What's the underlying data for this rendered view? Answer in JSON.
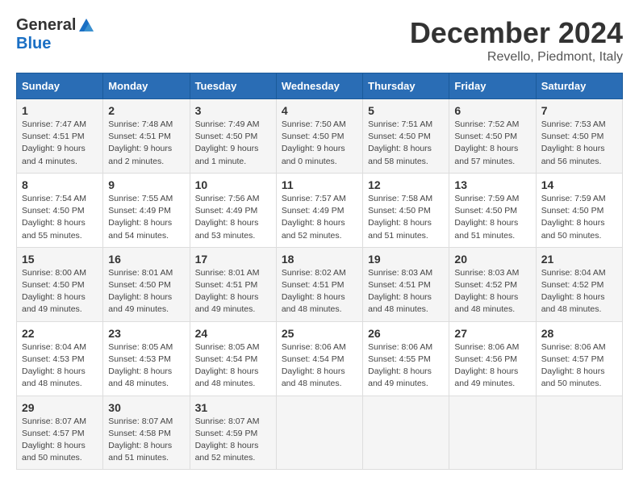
{
  "header": {
    "logo_general": "General",
    "logo_blue": "Blue",
    "title": "December 2024",
    "subtitle": "Revello, Piedmont, Italy"
  },
  "days_of_week": [
    "Sunday",
    "Monday",
    "Tuesday",
    "Wednesday",
    "Thursday",
    "Friday",
    "Saturday"
  ],
  "weeks": [
    [
      {
        "day": "1",
        "detail": "Sunrise: 7:47 AM\nSunset: 4:51 PM\nDaylight: 9 hours\nand 4 minutes."
      },
      {
        "day": "2",
        "detail": "Sunrise: 7:48 AM\nSunset: 4:51 PM\nDaylight: 9 hours\nand 2 minutes."
      },
      {
        "day": "3",
        "detail": "Sunrise: 7:49 AM\nSunset: 4:50 PM\nDaylight: 9 hours\nand 1 minute."
      },
      {
        "day": "4",
        "detail": "Sunrise: 7:50 AM\nSunset: 4:50 PM\nDaylight: 9 hours\nand 0 minutes."
      },
      {
        "day": "5",
        "detail": "Sunrise: 7:51 AM\nSunset: 4:50 PM\nDaylight: 8 hours\nand 58 minutes."
      },
      {
        "day": "6",
        "detail": "Sunrise: 7:52 AM\nSunset: 4:50 PM\nDaylight: 8 hours\nand 57 minutes."
      },
      {
        "day": "7",
        "detail": "Sunrise: 7:53 AM\nSunset: 4:50 PM\nDaylight: 8 hours\nand 56 minutes."
      }
    ],
    [
      {
        "day": "8",
        "detail": "Sunrise: 7:54 AM\nSunset: 4:50 PM\nDaylight: 8 hours\nand 55 minutes."
      },
      {
        "day": "9",
        "detail": "Sunrise: 7:55 AM\nSunset: 4:49 PM\nDaylight: 8 hours\nand 54 minutes."
      },
      {
        "day": "10",
        "detail": "Sunrise: 7:56 AM\nSunset: 4:49 PM\nDaylight: 8 hours\nand 53 minutes."
      },
      {
        "day": "11",
        "detail": "Sunrise: 7:57 AM\nSunset: 4:49 PM\nDaylight: 8 hours\nand 52 minutes."
      },
      {
        "day": "12",
        "detail": "Sunrise: 7:58 AM\nSunset: 4:50 PM\nDaylight: 8 hours\nand 51 minutes."
      },
      {
        "day": "13",
        "detail": "Sunrise: 7:59 AM\nSunset: 4:50 PM\nDaylight: 8 hours\nand 51 minutes."
      },
      {
        "day": "14",
        "detail": "Sunrise: 7:59 AM\nSunset: 4:50 PM\nDaylight: 8 hours\nand 50 minutes."
      }
    ],
    [
      {
        "day": "15",
        "detail": "Sunrise: 8:00 AM\nSunset: 4:50 PM\nDaylight: 8 hours\nand 49 minutes."
      },
      {
        "day": "16",
        "detail": "Sunrise: 8:01 AM\nSunset: 4:50 PM\nDaylight: 8 hours\nand 49 minutes."
      },
      {
        "day": "17",
        "detail": "Sunrise: 8:01 AM\nSunset: 4:51 PM\nDaylight: 8 hours\nand 49 minutes."
      },
      {
        "day": "18",
        "detail": "Sunrise: 8:02 AM\nSunset: 4:51 PM\nDaylight: 8 hours\nand 48 minutes."
      },
      {
        "day": "19",
        "detail": "Sunrise: 8:03 AM\nSunset: 4:51 PM\nDaylight: 8 hours\nand 48 minutes."
      },
      {
        "day": "20",
        "detail": "Sunrise: 8:03 AM\nSunset: 4:52 PM\nDaylight: 8 hours\nand 48 minutes."
      },
      {
        "day": "21",
        "detail": "Sunrise: 8:04 AM\nSunset: 4:52 PM\nDaylight: 8 hours\nand 48 minutes."
      }
    ],
    [
      {
        "day": "22",
        "detail": "Sunrise: 8:04 AM\nSunset: 4:53 PM\nDaylight: 8 hours\nand 48 minutes."
      },
      {
        "day": "23",
        "detail": "Sunrise: 8:05 AM\nSunset: 4:53 PM\nDaylight: 8 hours\nand 48 minutes."
      },
      {
        "day": "24",
        "detail": "Sunrise: 8:05 AM\nSunset: 4:54 PM\nDaylight: 8 hours\nand 48 minutes."
      },
      {
        "day": "25",
        "detail": "Sunrise: 8:06 AM\nSunset: 4:54 PM\nDaylight: 8 hours\nand 48 minutes."
      },
      {
        "day": "26",
        "detail": "Sunrise: 8:06 AM\nSunset: 4:55 PM\nDaylight: 8 hours\nand 49 minutes."
      },
      {
        "day": "27",
        "detail": "Sunrise: 8:06 AM\nSunset: 4:56 PM\nDaylight: 8 hours\nand 49 minutes."
      },
      {
        "day": "28",
        "detail": "Sunrise: 8:06 AM\nSunset: 4:57 PM\nDaylight: 8 hours\nand 50 minutes."
      }
    ],
    [
      {
        "day": "29",
        "detail": "Sunrise: 8:07 AM\nSunset: 4:57 PM\nDaylight: 8 hours\nand 50 minutes."
      },
      {
        "day": "30",
        "detail": "Sunrise: 8:07 AM\nSunset: 4:58 PM\nDaylight: 8 hours\nand 51 minutes."
      },
      {
        "day": "31",
        "detail": "Sunrise: 8:07 AM\nSunset: 4:59 PM\nDaylight: 8 hours\nand 52 minutes."
      },
      {
        "day": "",
        "detail": ""
      },
      {
        "day": "",
        "detail": ""
      },
      {
        "day": "",
        "detail": ""
      },
      {
        "day": "",
        "detail": ""
      }
    ]
  ]
}
